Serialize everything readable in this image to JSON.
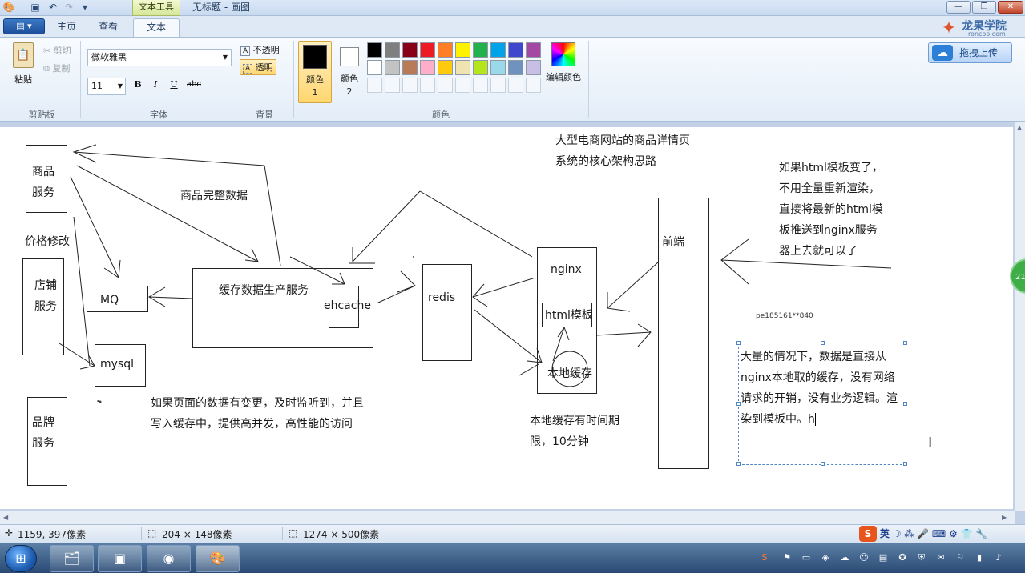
{
  "window": {
    "context_tab": "文本工具",
    "title": "无标题 - 画图",
    "min_icon": "minimize-icon",
    "max_icon": "restore-icon",
    "close_icon": "close-icon"
  },
  "tabs": {
    "menu": "▤ ▾",
    "items": [
      "主页",
      "查看",
      "文本"
    ],
    "active": "文本"
  },
  "brand": {
    "name": "龙果学院",
    "url": "roncoo.com",
    "upload": "拖拽上传"
  },
  "ribbon": {
    "clipboard": {
      "paste": "粘贴",
      "cut": "剪切",
      "copy": "复制",
      "label": "剪贴板"
    },
    "font": {
      "family": "微软雅黑",
      "size": "11",
      "bold": "B",
      "italic": "I",
      "underline": "U",
      "strike": "abc",
      "label": "字体"
    },
    "background": {
      "opaque": "不透明",
      "transparent": "透明",
      "label": "背景"
    },
    "colors": {
      "color1": "颜色 1",
      "color2": "颜色 2",
      "color1_value": "#000000",
      "color2_value": "#ffffff",
      "edit": "编辑颜色",
      "label": "颜色",
      "palette_row1": [
        "#000000",
        "#7f7f7f",
        "#880015",
        "#ed1c24",
        "#ff7f27",
        "#fff200",
        "#22b14c",
        "#00a2e8",
        "#3f48cc",
        "#a349a4"
      ],
      "palette_row2": [
        "#ffffff",
        "#c3c3c3",
        "#b97a57",
        "#ffaec9",
        "#ffc90e",
        "#efe4b0",
        "#b5e61d",
        "#99d9ea",
        "#7092be",
        "#c8bfe7"
      ]
    }
  },
  "diagram": {
    "goods_service": "商品服务",
    "price_change": "价格修改",
    "store_service": "店铺服务",
    "brand_service": "品牌服务",
    "mq": "MQ",
    "mysql": "mysql",
    "cache_producer": "缓存数据生产服务",
    "ehcache": "ehcache",
    "full_data": "商品完整数据",
    "redis": "redis",
    "nginx": "nginx",
    "html_template": "html模板",
    "local_cache": "本地缓存",
    "frontend": "前端",
    "title_line1": "大型电商网站的商品详情页",
    "title_line2": "系统的核心架构思路",
    "note_change_1": "如果页面的数据有变更，及时监听到，并且",
    "note_change_2": "写入缓存中，提供高并发，高性能的访问",
    "note_local_1": "本地缓存有时间期",
    "note_local_2": "限，10分钟",
    "note_tpl_1": "如果html模板变了，",
    "note_tpl_2": "不用全量重新渲染，",
    "note_tpl_3": "直接将最新的html模",
    "note_tpl_4": "板推送到nginx服务",
    "note_tpl_5": "器上去就可以了",
    "watermark": "pe185161**840",
    "edit_text": "大量的情况下，数据是直接从nginx本地取的缓存，没有网络请求的开销，没有业务逻辑。渲染到模板中。h",
    "dot": "·"
  },
  "status": {
    "cursor_pos": "1159, 397像素",
    "selection_size": "204 × 148像素",
    "canvas_size": "1274 × 500像素",
    "ime": "英"
  },
  "side_badge": "21"
}
